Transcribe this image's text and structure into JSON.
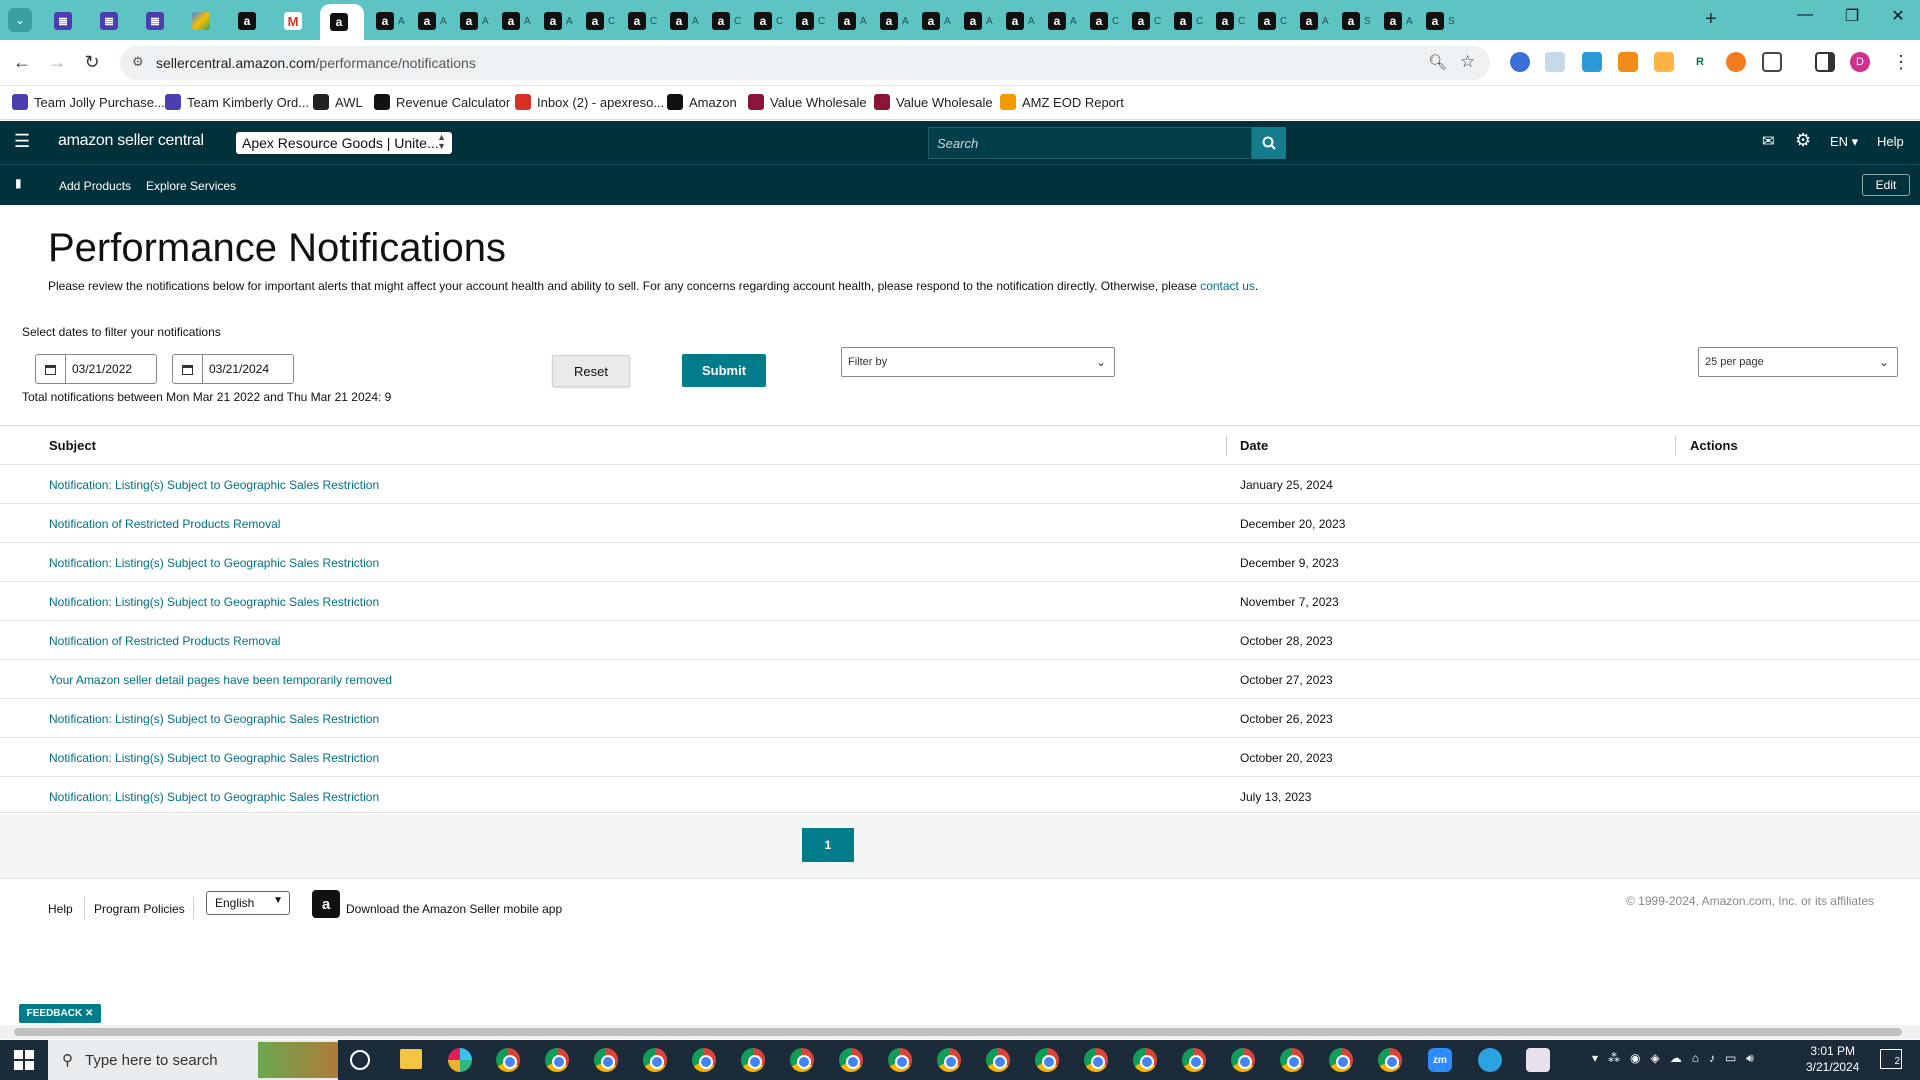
{
  "browser": {
    "tabs": [
      {
        "icon": "tasks-icon",
        "glyph": "≣",
        "kind": "list"
      },
      {
        "icon": "tasks-icon",
        "glyph": "≣",
        "kind": "list"
      },
      {
        "icon": "tasks-icon",
        "glyph": "≣",
        "kind": "list"
      },
      {
        "icon": "drive-icon",
        "glyph": "",
        "kind": "multi"
      },
      {
        "icon": "amazon-icon",
        "glyph": "a",
        "kind": "amz"
      },
      {
        "icon": "gmail-icon",
        "glyph": "M",
        "kind": "gmail"
      },
      {
        "icon": "amazon-icon",
        "glyph": "a",
        "kind": "amz",
        "active": true
      }
    ],
    "tab_initials": [
      "A",
      "A",
      "A",
      "A",
      "A",
      "C",
      "C",
      "A",
      "C",
      "C",
      "C",
      "A",
      "A",
      "A",
      "A",
      "A",
      "A",
      "C",
      "C",
      "C",
      "C",
      "C",
      "A",
      "S",
      "A",
      "S"
    ],
    "url_host": "sellercentral.amazon.com",
    "url_path": "/performance/notifications",
    "profile_initial": "D",
    "bookmarks": [
      {
        "label": "Team Jolly Purchase...",
        "icon": "tasks-icon",
        "color": "#4b3fb0"
      },
      {
        "label": "Team Kimberly Ord...",
        "icon": "tasks-icon",
        "color": "#4b3fb0"
      },
      {
        "label": "AWL",
        "icon": "awl-icon",
        "color": "#222"
      },
      {
        "label": "Revenue Calculator",
        "icon": "amazon-icon",
        "color": "#111"
      },
      {
        "label": "Inbox (2) - apexreso...",
        "icon": "gmail-icon",
        "color": "#d93025"
      },
      {
        "label": "Amazon",
        "icon": "amazon-icon",
        "color": "#111"
      },
      {
        "label": "Value Wholesale",
        "icon": "vw-icon",
        "color": "#8a1538"
      },
      {
        "label": "Value Wholesale",
        "icon": "vw-icon",
        "color": "#8a1538"
      },
      {
        "label": "AMZ EOD Report",
        "icon": "chart-icon",
        "color": "#f29900"
      }
    ]
  },
  "header": {
    "logo_text": "amazon seller central",
    "store": "Apex Resource Goods | Unite...",
    "search_placeholder": "Search",
    "lang": "EN",
    "help": "Help"
  },
  "subnav": {
    "items": [
      "Add Products",
      "Explore Services"
    ],
    "edit": "Edit"
  },
  "page": {
    "title": "Performance Notifications",
    "intro": "Please review the notifications below for important alerts that might affect your account health and ability to sell. For any concerns regarding account health, please respond to the notification directly. Otherwise, please ",
    "contact_link": "contact us",
    "intro_end": ".",
    "date_filter_label": "Select dates to filter your notifications",
    "start_date": "03/21/2022",
    "end_date": "03/21/2024",
    "total_text": "Total notifications between Mon Mar 21 2022 and Thu Mar 21 2024: 9",
    "reset": "Reset",
    "submit": "Submit",
    "filter_by": "Filter by",
    "per_page": "25 per page"
  },
  "table": {
    "headers": {
      "subject": "Subject",
      "date": "Date",
      "actions": "Actions"
    },
    "rows": [
      {
        "subject": "Notification: Listing(s) Subject to Geographic Sales Restriction",
        "date": "January 25, 2024"
      },
      {
        "subject": "Notification of Restricted Products Removal",
        "date": "December 20, 2023"
      },
      {
        "subject": "Notification: Listing(s) Subject to Geographic Sales Restriction",
        "date": "December 9, 2023"
      },
      {
        "subject": "Notification: Listing(s) Subject to Geographic Sales Restriction",
        "date": "November 7, 2023"
      },
      {
        "subject": "Notification of Restricted Products Removal",
        "date": "October 28, 2023"
      },
      {
        "subject": "Your Amazon seller detail pages have been temporarily removed",
        "date": "October 27, 2023"
      },
      {
        "subject": "Notification: Listing(s) Subject to Geographic Sales Restriction",
        "date": "October 26, 2023"
      },
      {
        "subject": "Notification: Listing(s) Subject to Geographic Sales Restriction",
        "date": "October 20, 2023"
      },
      {
        "subject": "Notification: Listing(s) Subject to Geographic Sales Restriction",
        "date": "July 13, 2023"
      }
    ]
  },
  "pagination": {
    "current": "1"
  },
  "footer": {
    "help": "Help",
    "policies": "Program Policies",
    "language": "English",
    "app": "Download the Amazon Seller mobile app",
    "copyright": "© 1999-2024, Amazon.com, Inc. or its affiliates"
  },
  "feedback": "FEEDBACK",
  "taskbar": {
    "search_placeholder": "Type here to search",
    "time": "3:01 PM",
    "date": "3/21/2024",
    "notifications": "2"
  },
  "colors": {
    "header": "#01313a",
    "accent": "#007c8a",
    "link": "#007185",
    "tabstrip": "#5ec3c3"
  }
}
